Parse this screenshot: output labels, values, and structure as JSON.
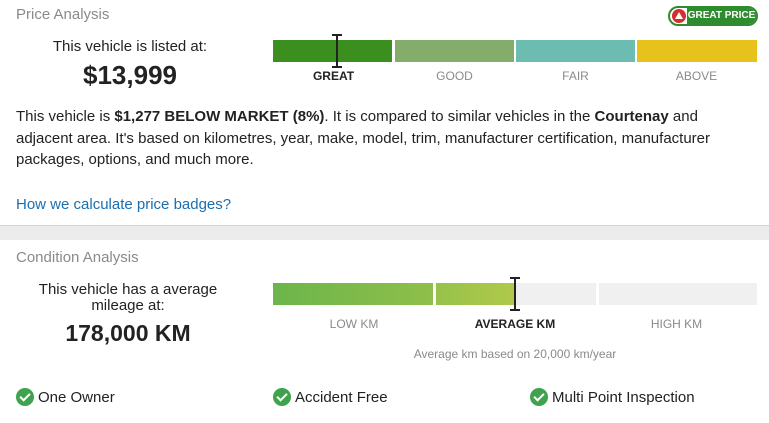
{
  "price_analysis": {
    "title": "Price Analysis",
    "badge": {
      "text": "GREAT PRICE",
      "icon": "maple-leaf-icon"
    },
    "listed_label": "This vehicle is listed at:",
    "price": "$13,999",
    "scale": {
      "segments": [
        {
          "label": "GREAT",
          "color": "#3a8f1e",
          "active": true
        },
        {
          "label": "GOOD",
          "color": "#84ad6b",
          "active": false
        },
        {
          "label": "FAIR",
          "color": "#6dbcb2",
          "active": false
        },
        {
          "label": "ABOVE",
          "color": "#e8c21c",
          "active": false
        }
      ]
    },
    "description": {
      "p1": "This vehicle is ",
      "amount": "$1,277 BELOW MARKET (8%)",
      "p2": ". It is compared to similar vehicles in the ",
      "city": "Courtenay",
      "p3": " and adjacent area. It's based on kilometres, year, make, model, trim, manufacturer certification, manufacturer packages, options, and much more."
    },
    "link": "How we calculate price badges?"
  },
  "condition_analysis": {
    "title": "Condition Analysis",
    "mileage_label": "This vehicle has a average mileage at:",
    "mileage": "178,000 KM",
    "scale": {
      "segments": [
        {
          "label": "LOW KM",
          "color": "#72b84a",
          "active": false
        },
        {
          "label": "AVERAGE KM",
          "color": "#a8c94a",
          "active": true
        },
        {
          "label": "HIGH KM",
          "color": "#f0f0f0",
          "active": false
        }
      ]
    },
    "note": "Average km based on 20,000 km/year",
    "features": [
      {
        "label": "One Owner",
        "icon": "check-circle-icon"
      },
      {
        "label": "Accident Free",
        "icon": "check-circle-icon"
      },
      {
        "label": "Multi Point Inspection",
        "icon": "check-circle-icon"
      }
    ]
  }
}
